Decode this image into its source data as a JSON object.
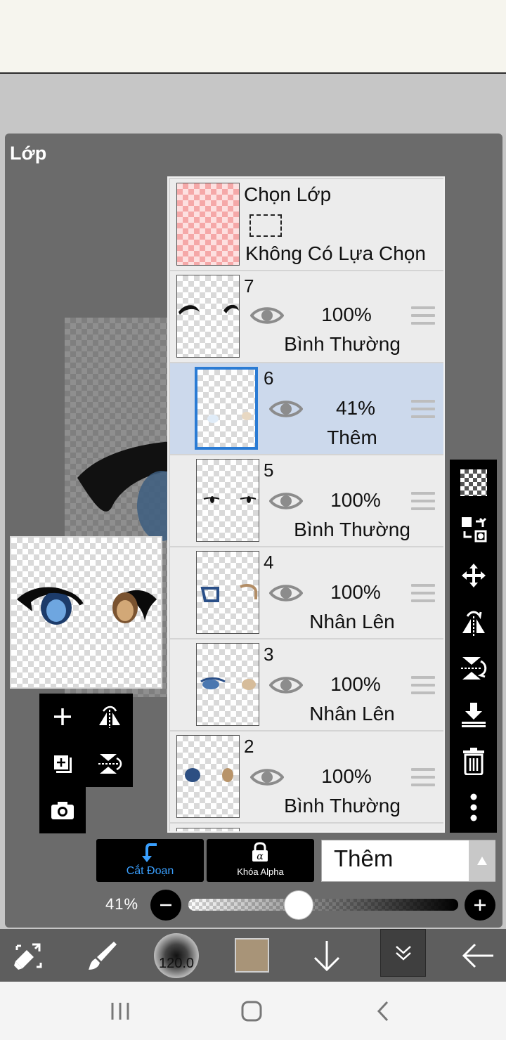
{
  "panel": {
    "title": "Lớp"
  },
  "selection_layer": {
    "title": "Chọn Lớp",
    "status": "Không Có Lựa Chọn"
  },
  "layers": [
    {
      "number": "7",
      "opacity": "100%",
      "blend": "Bình Thường",
      "selected": false
    },
    {
      "number": "6",
      "opacity": "41%",
      "blend": "Thêm",
      "selected": true
    },
    {
      "number": "5",
      "opacity": "100%",
      "blend": "Bình Thường",
      "selected": false
    },
    {
      "number": "4",
      "opacity": "100%",
      "blend": "Nhân Lên",
      "selected": false
    },
    {
      "number": "3",
      "opacity": "100%",
      "blend": "Nhân Lên",
      "selected": false
    },
    {
      "number": "2",
      "opacity": "100%",
      "blend": "Bình Thường",
      "selected": false
    }
  ],
  "controls": {
    "clip_label": "Cắt Đoạn",
    "alpha_lock_label": "Khóa Alpha",
    "blend_mode": "Thêm",
    "opacity_label": "41%",
    "opacity_value": 0.41
  },
  "toolbar": {
    "brush_size": "120.0",
    "color": "#a89478"
  },
  "colors": {
    "accent_blue": "#2a7bd4",
    "selected_row": "#ccd9ec",
    "panel_bg": "#6b6b6b"
  },
  "icons": {
    "right_bar": [
      "transparency-icon",
      "layer-transform-icon",
      "move-icon",
      "flip-horizontal-icon",
      "flip-vertical-icon",
      "merge-down-icon",
      "trash-icon",
      "more-icon"
    ],
    "mini_pad": [
      "add-layer-icon",
      "flip-horizontal-icon",
      "add-layer-copy-icon",
      "flip-vertical-icon",
      "camera-icon"
    ],
    "bottom_bar": [
      "transform-icon",
      "brush-icon",
      "brush-size-icon",
      "color-swatch",
      "arrow-down-icon",
      "collapse-icon",
      "back-arrow-icon"
    ],
    "system_nav": [
      "recent-apps-icon",
      "home-icon",
      "back-icon"
    ]
  }
}
